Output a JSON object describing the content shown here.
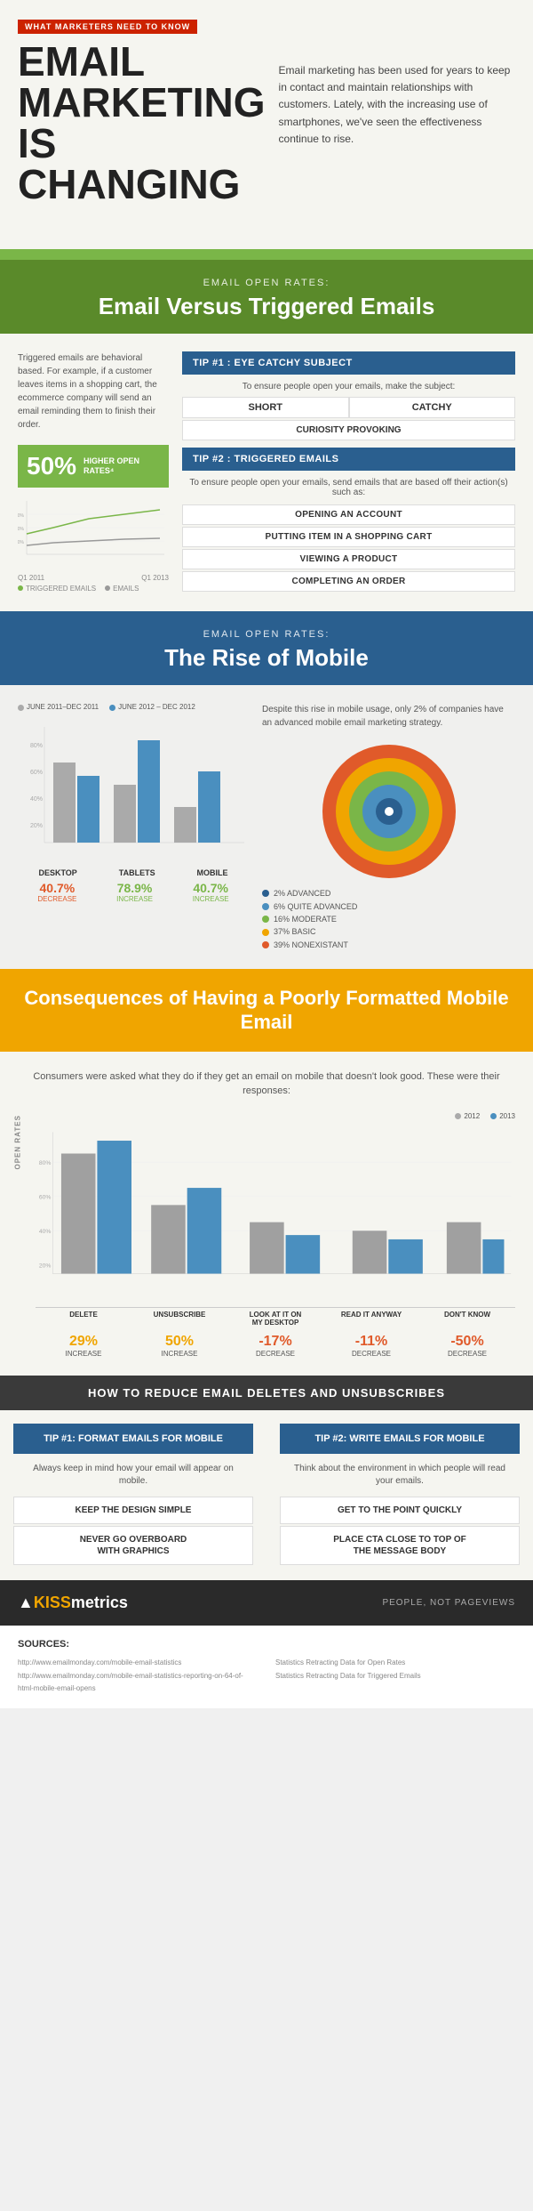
{
  "header": {
    "red_banner": "WHAT MARKETERS NEED TO KNOW",
    "title_line1": "EMAIL",
    "title_line2": "MARKETING",
    "title_line3": "IS CHANGING",
    "description": "Email marketing has been used for years to keep in contact and maintain relationships with customers. Lately, with the increasing use of smartphones, we've seen the effectiveness continue to rise."
  },
  "section1": {
    "sub_label": "EMAIL OPEN RATES:",
    "heading": "Email Versus Triggered Emails",
    "left_text": "Triggered emails are behavioral based. For example, if a customer leaves items in a shopping cart, the ecommerce company will send an email reminding them to finish their order.",
    "fifty_percent": "50%",
    "higher_open": "HIGHER OPEN RATES⁴",
    "chart_q1": "Q1 2011",
    "chart_q2": "Q1 2013",
    "legend_triggered": "TRIGGERED EMAILS",
    "legend_emails": "EMAILS",
    "tip1_label": "TIP #1 : EYE CATCHY SUBJECT",
    "tip1_sub": "To ensure people open your emails, make the subject:",
    "short_label": "SHORT",
    "catchy_label": "CATCHY",
    "curiosity_label": "CURIOSITY PROVOKING",
    "tip2_label": "TIP #2 : TRIGGERED EMAILS",
    "tip2_sub": "To ensure people open your emails, send emails that are based off their action(s) such as:",
    "tip2_items": [
      "OPENING AN ACCOUNT",
      "PUTTING ITEM IN A SHOPPING CART",
      "VIEWING A PRODUCT",
      "COMPLETING AN ORDER"
    ]
  },
  "section2": {
    "sub_label": "EMAIL OPEN RATES:",
    "heading": "The Rise of Mobile",
    "legend1": "JUNE 2011–DEC 2011",
    "legend2": "JUNE 2012 – DEC 2012",
    "bar_labels": [
      "DESKTOP",
      "TABLETS",
      "MOBILE"
    ],
    "stat1_num": "40.7%",
    "stat1_desc": "DECREASE",
    "stat2_num": "78.9%",
    "stat2_desc": "INCREASE",
    "stat3_num": "40.7%",
    "stat3_desc": "INCREASE",
    "description": "Despite this rise in mobile usage, only 2% of companies have an advanced mobile email marketing strategy.",
    "circle_labels": [
      {
        "pct": "2% ADVANCED",
        "color": "#2a5f8f"
      },
      {
        "pct": "6% QUITE ADVANCED",
        "color": "#4a8fbf"
      },
      {
        "pct": "16% MODERATE",
        "color": "#7ab648"
      },
      {
        "pct": "37% BASIC",
        "color": "#f0a500"
      },
      {
        "pct": "39% NONEXISTANT",
        "color": "#e05a2a"
      }
    ]
  },
  "section3": {
    "heading": "Consequences of Having a Poorly Formatted Mobile Email",
    "description": "Consumers were asked what they do if they get an email on mobile that doesn't look good. These were their responses:",
    "legend1": "2012",
    "legend2": "2013",
    "bar_xlabels": [
      "DELETE",
      "UNSUBSCRIBE",
      "LOOK AT IT ON MY DESKTOP",
      "READ IT ANYWAY",
      "DON'T KNOW"
    ],
    "stat1_num": "29%",
    "stat1_desc": "INCREASE",
    "stat2_num": "50%",
    "stat2_desc": "INCREASE",
    "stat3_num": "-17%",
    "stat3_desc": "DECREASE",
    "stat4_num": "-11%",
    "stat4_desc": "DECREASE",
    "stat5_num": "-50%",
    "stat5_desc": "DECREASE"
  },
  "section4": {
    "reduce_header": "HOW TO REDUCE EMAIL DELETES AND UNSUBSCRIBES",
    "tip1_header": "TIP #1: FORMAT EMAILS FOR MOBILE",
    "tip1_sub": "Always keep in mind how your email will appear on mobile.",
    "tip1_items": [
      "KEEP THE DESIGN SIMPLE",
      "NEVER GO OVERBOARD WITH GRAPHICS"
    ],
    "tip2_header": "TIP #2: WRITE EMAILS FOR MOBILE",
    "tip2_sub": "Think about the environment in which people will read your emails.",
    "tip2_items": [
      "GET TO THE POINT QUICKLY",
      "PLACE CTA CLOSE TO TOP OF THE MESSAGE BODY"
    ]
  },
  "footer": {
    "logo": "KISSmetrics",
    "tagline": "PEOPLE, NOT PAGEVIEWS"
  },
  "sources": {
    "title": "SOURCES:",
    "items": [
      "http://www.emailmonday.com/mobile-email-statistics",
      "http://www.emailmonday.com/mobile-email-statistics-reporting-on-64-of-html-mobile-email-opens",
      "Statistics Retracting Data for Open Rates",
      "Statistics Retracting Data for Triggered Emails"
    ]
  }
}
